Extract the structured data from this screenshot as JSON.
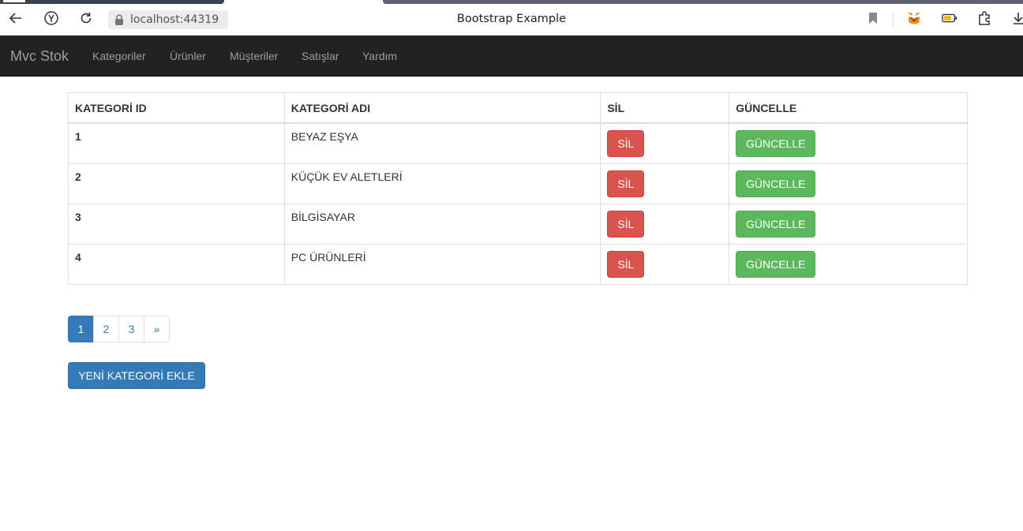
{
  "browser": {
    "url": "localhost:44319",
    "tab_title": "Bootstrap Example",
    "icons": [
      "back-icon",
      "yandex-icon",
      "reload-icon",
      "lock-icon",
      "bookmark-icon",
      "metamask-icon",
      "battery-icon",
      "extensions-icon",
      "download-icon"
    ]
  },
  "navbar": {
    "brand": "Mvc Stok",
    "items": [
      "Kategoriler",
      "Ürünler",
      "Müşteriler",
      "Satışlar",
      "Yardım"
    ]
  },
  "table": {
    "headers": [
      "KATEGORİ ID",
      "KATEGORİ ADI",
      "SİL",
      "GÜNCELLE"
    ],
    "rows": [
      {
        "id": "1",
        "name": "BEYAZ EŞYA",
        "delete_label": "SİL",
        "update_label": "GÜNCELLE"
      },
      {
        "id": "2",
        "name": "KÜÇÜK EV ALETLERİ",
        "delete_label": "SİL",
        "update_label": "GÜNCELLE"
      },
      {
        "id": "3",
        "name": "BİLGİSAYAR",
        "delete_label": "SİL",
        "update_label": "GÜNCELLE"
      },
      {
        "id": "4",
        "name": "PC ÜRÜNLERİ",
        "delete_label": "SİL",
        "update_label": "GÜNCELLE"
      }
    ]
  },
  "pagination": {
    "pages": [
      "1",
      "2",
      "3"
    ],
    "next": "»",
    "current": "1"
  },
  "add_button": "YENİ KATEGORİ EKLE",
  "colors": {
    "navbar_bg": "#222222",
    "danger": "#d9534f",
    "success": "#5cb85c",
    "primary": "#337ab7"
  }
}
